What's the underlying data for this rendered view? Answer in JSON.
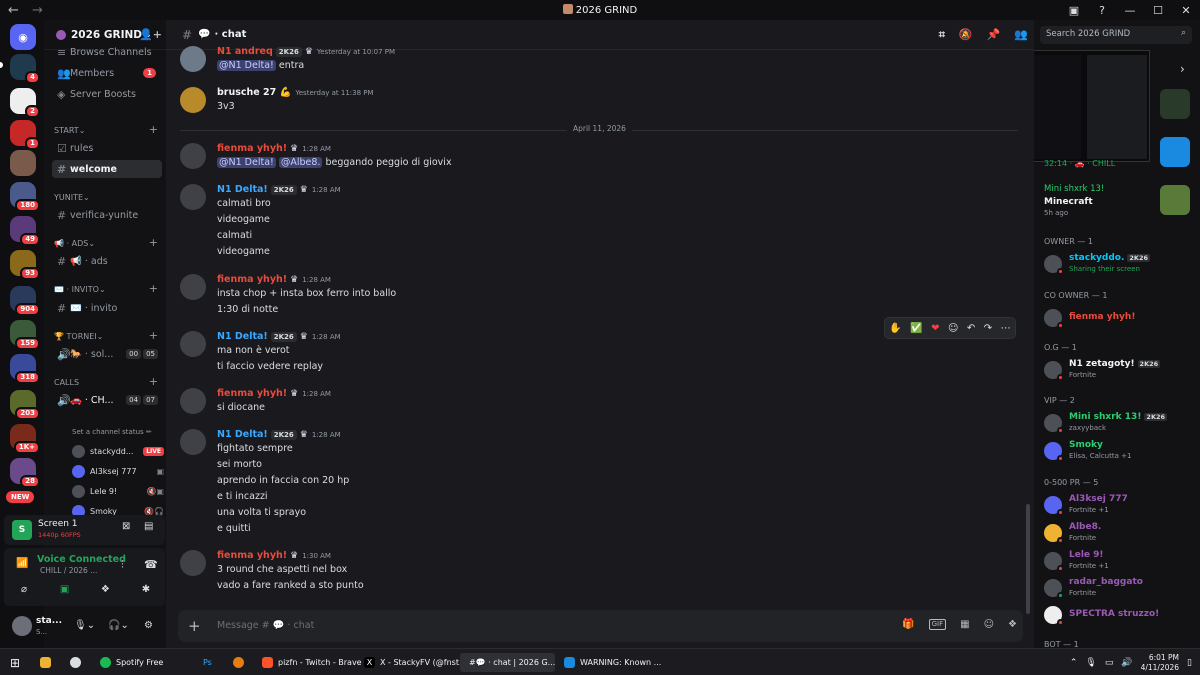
{
  "window": {
    "title": "2026 GRIND"
  },
  "server": {
    "name": "2026 GRIND"
  },
  "rail_badges": [
    "4",
    "2",
    "1",
    "180",
    "49",
    "93",
    "904",
    "159",
    "318",
    "203",
    "1K+",
    "28"
  ],
  "rail_new": "NEW",
  "sidebar": {
    "browse": "Browse Channels",
    "members": "Members",
    "members_badge": "1",
    "boosts": "Server Boosts",
    "cat_start": "START",
    "rules": "rules",
    "welcome": "welcome",
    "cat_yunite": "YUNITE",
    "verifica": "verifica-yunite",
    "cat_ads": "📢 · ADS",
    "ads": "📢 · ads",
    "cat_invito": "✉️ · invito",
    "invito": "✉️ · invito",
    "cat_tornei": "🏆 TORNEI",
    "tornei_vc": "🐎 · sol...",
    "tornei_ctr": [
      "00",
      "05"
    ],
    "cat_calls": "CALLS",
    "calls_vc": "🚗 · CH...",
    "calls_ctr": [
      "04",
      "07"
    ],
    "set_status": "Set a channel status ✏",
    "voice_users": [
      {
        "name": "stackydd...",
        "tag": "LIVE"
      },
      {
        "name": "Al3ksej 777",
        "tag": ""
      },
      {
        "name": "Lele 9!",
        "tag": ""
      },
      {
        "name": "Smoky",
        "tag": ""
      }
    ]
  },
  "screen_panel": {
    "title": "Screen 1",
    "quality": "1440p 60FPS"
  },
  "voice_panel": {
    "status": "Voice Connected",
    "channel": "CHILL / 2026 ..."
  },
  "user_panel": {
    "name": "sta...",
    "status": "S..."
  },
  "chat": {
    "channel": "· chat",
    "date_divider": "April 11, 2026",
    "placeholder": "Message # 💬 · chat",
    "messages": [
      {
        "name": "N1 andreq",
        "tag": "2K26",
        "time": "Yesterday at 10:07 PM",
        "lines": [
          "@N1 Delta! entra"
        ]
      },
      {
        "name": "brusche 27 💪",
        "tag": "",
        "time": "Yesterday at 11:38 PM",
        "lines": [
          "3v3"
        ]
      },
      {
        "name": "fienma yhyh!",
        "tag": "",
        "time": "1:28 AM",
        "lines": [
          "@N1 Delta! @Albe8. beggando peggio di giovix"
        ]
      },
      {
        "name": "N1 Delta!",
        "tag": "2K26",
        "time": "1:28 AM",
        "lines": [
          "calmati bro",
          "videogame",
          "calmati",
          "videogame"
        ]
      },
      {
        "name": "fienma yhyh!",
        "tag": "",
        "time": "1:28 AM",
        "lines": [
          "insta chop + insta box ferro into ballo",
          "1:30 di notte"
        ]
      },
      {
        "name": "N1 Delta!",
        "tag": "2K26",
        "time": "1:28 AM",
        "lines": [
          "ma non è verot",
          "ti faccio vedere replay"
        ]
      },
      {
        "name": "fienma yhyh!",
        "tag": "",
        "time": "1:28 AM",
        "lines": [
          "si diocane"
        ]
      },
      {
        "name": "N1 Delta!",
        "tag": "2K26",
        "time": "1:28 AM",
        "lines": [
          "fightato sempre",
          "sei morto",
          "aprendo in faccia con 20 hp",
          "e ti incazzi",
          "una volta ti sprayo",
          "e quitti"
        ]
      },
      {
        "name": "fienma yhyh!",
        "tag": "",
        "time": "1:30 AM",
        "lines": [
          "3 round che aspetti nel box",
          "vado a fare ranked a sto punto"
        ]
      }
    ]
  },
  "members": {
    "search_placeholder": "Search 2026 GRIND",
    "pip_status": "32:14 · 🚗 · CHILL",
    "activity": {
      "name": "Mini shxrk 13!",
      "game": "Minecraft",
      "time": "5h ago"
    },
    "groups": [
      {
        "title": "OWNER — 1",
        "members": [
          {
            "name": "stackyddo.",
            "tag": "2K26",
            "sub": "Sharing their screen"
          }
        ]
      },
      {
        "title": "CO OWNER — 1",
        "members": [
          {
            "name": "fienma yhyh!",
            "tag": "",
            "sub": ""
          }
        ]
      },
      {
        "title": "O.G — 1",
        "members": [
          {
            "name": "N1 zetagoty!",
            "tag": "2K26",
            "sub": "Fortnite"
          }
        ]
      },
      {
        "title": "VIP — 2",
        "members": [
          {
            "name": "Mini shxrk 13!",
            "tag": "2K26",
            "sub": "zaxyyback"
          },
          {
            "name": "Smoky",
            "tag": "",
            "sub": "Elisa, Calcutta +1"
          }
        ]
      },
      {
        "title": "0-500 pr — 5",
        "members": [
          {
            "name": "Al3ksej 777",
            "tag": "",
            "sub": "Fortnite +1"
          },
          {
            "name": "Albe8.",
            "tag": "",
            "sub": "Fortnite"
          },
          {
            "name": "Lele 9!",
            "tag": "",
            "sub": "Fortnite +1"
          },
          {
            "name": "radar_baggato",
            "tag": "",
            "sub": "Fortnite"
          },
          {
            "name": "SPECTRA struzzo!",
            "tag": "",
            "sub": ""
          }
        ]
      },
      {
        "title": "BOT — 1",
        "members": []
      }
    ]
  },
  "taskbar": {
    "items": [
      "Spotify Free",
      "Ps",
      "pizfn - Twitch - Brave",
      "X - StackyFV (@fnst...",
      "#💬 · chat | 2026 G...",
      "WARNING: Known ..."
    ],
    "time": "6:01 PM",
    "date": "4/11/2026"
  },
  "colors": {
    "owner": "#00c8ff",
    "red_role": "#e74c3c",
    "blue_role": "#3ba8ff",
    "vip": "#2ecc71",
    "pr": "#9b59b6"
  }
}
